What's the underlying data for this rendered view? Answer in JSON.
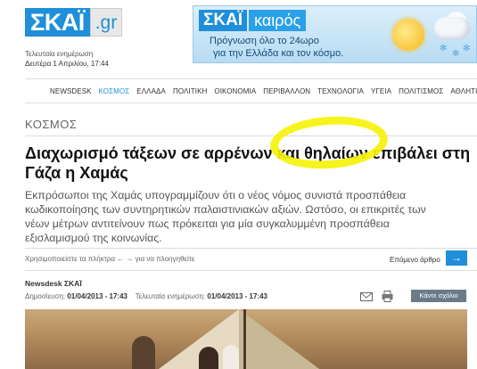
{
  "header": {
    "logo_main": "ΣΚΑΪ",
    "logo_domain": ".gr",
    "updated_label": "Τελευταία ενημέρωση",
    "updated_date": "Δευτέρα 1 Απριλίου, 17:44"
  },
  "weather_banner": {
    "logo_main": "ΣΚΑΪ",
    "logo_sub": "καιρός",
    "line1": "Πρόγνωση όλο το 24ωρο",
    "line2": "για την Ελλάδα και τον κόσμο."
  },
  "nav": {
    "items": [
      {
        "label": "NEWSDESK",
        "active": false
      },
      {
        "label": "ΚΟΣΜΟΣ",
        "active": true
      },
      {
        "label": "ΕΛΛΑΔΑ",
        "active": false
      },
      {
        "label": "ΠΟΛΙΤΙΚΗ",
        "active": false
      },
      {
        "label": "ΟΙΚΟΝΟΜΙΑ",
        "active": false
      },
      {
        "label": "ΠΕΡΙΒΑΛΛΟΝ",
        "active": false
      },
      {
        "label": "ΤΕΧΝΟΛΟΓΙΑ",
        "active": false
      },
      {
        "label": "ΥΓΕΙΑ",
        "active": false
      },
      {
        "label": "ΠΟΛΙΤΙΣΜΟΣ",
        "active": false
      },
      {
        "label": "ΑΘΛΗΤΙΣΜ",
        "active": false
      }
    ]
  },
  "article": {
    "section": "ΚΟΣΜΟΣ",
    "headline": "Διαχωρισμό τάξεων σε αρρένων και θηλαίων επιβάλει στη Γάζα η Χαμάς",
    "lead": "Εκπρόσωποι της Χαμάς υπογραμμίζουν ότι ο νέος νόμος συνιστά προσπάθεια κωδικοποίησης των συντηρητικών παλαιστινιακών αξιών. Ωστόσο, οι επικριτές των νέων μέτρων αντιτείνουν πως πρόκειται για μία συγκαλυμμένη προσπάθεια εξισλαμισμού της κοινωνίας.",
    "help_text": "Χρησιμοποιείστε τα πλήκτρα ← → για να πλοηγηθείτε",
    "next_label": "Επόμενο άρθρο",
    "next_arrow": "→",
    "author": "Newsdesk ΣΚΑΪ",
    "published_label": "Δημοσίευση:",
    "published_value": "01/04/2013 - 17:43",
    "updated_label": "Τελευταία ενημέρωση:",
    "updated_value": "01/04/2013 - 17:43",
    "comments_button": "Κάντε σχόλιο"
  },
  "colors": {
    "brand_blue": "#1e8fd8",
    "highlight_yellow": "#f6f20c"
  }
}
